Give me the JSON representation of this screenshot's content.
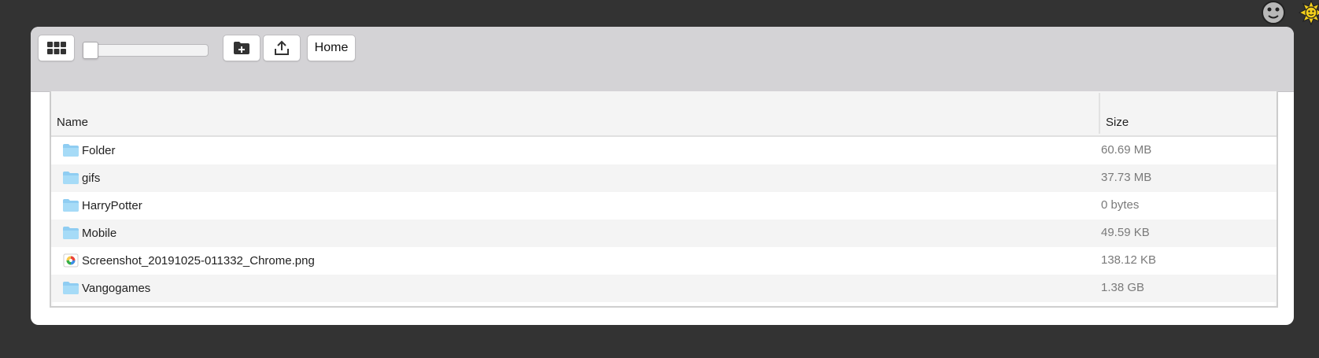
{
  "toolbar": {
    "grid_icon": "grid-view-icon",
    "slider_value": 0,
    "new_folder_icon": "new-folder-icon",
    "upload_icon": "upload-icon",
    "home_label": "Home"
  },
  "theme": {
    "dark_icon": "moon-face-icon",
    "light_icon": "sun-icon"
  },
  "table": {
    "headers": {
      "name": "Name",
      "size": "Size"
    },
    "rows": [
      {
        "name": "Folder",
        "size": "60.69 MB",
        "type": "folder"
      },
      {
        "name": "gifs",
        "size": "37.73 MB",
        "type": "folder"
      },
      {
        "name": "HarryPotter",
        "size": "0 bytes",
        "type": "folder"
      },
      {
        "name": "Mobile",
        "size": "49.59 KB",
        "type": "folder"
      },
      {
        "name": "Screenshot_20191025-011332_Chrome.png",
        "size": "138.12 KB",
        "type": "image"
      },
      {
        "name": "Vangogames",
        "size": "1.38 GB",
        "type": "folder"
      }
    ]
  },
  "colors": {
    "background": "#333333",
    "toolbar": "#d4d3d6",
    "folder": "#8fcdf2",
    "row_alt": "#f4f4f4"
  }
}
